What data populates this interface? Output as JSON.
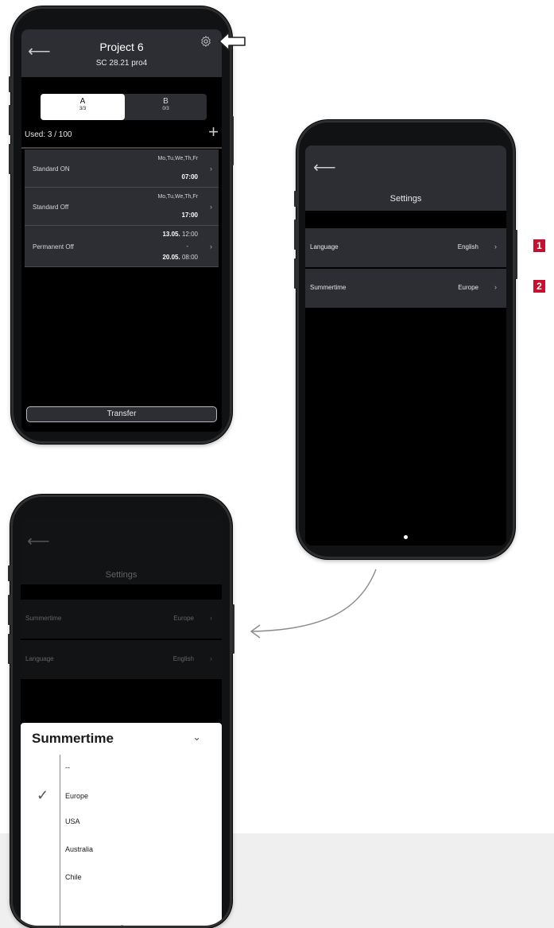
{
  "phone1": {
    "title": "Project 6",
    "subtitle": "SC 28.21 pro4",
    "tabs": [
      {
        "label": "A",
        "count": "3/3"
      },
      {
        "label": "B",
        "count": "0/3"
      }
    ],
    "used": "Used: 3 / 100",
    "rows": [
      {
        "name": "Standard  ON",
        "days": "Mo,Tu,We,Th,Fr",
        "time": "07:00"
      },
      {
        "name": "Standard  Off",
        "days": "Mo,Tu,We,Th,Fr",
        "time": "17:00"
      },
      {
        "name": "Permanent  Off",
        "start_date": "13.05.",
        "start_time": "12:00",
        "sep": "-",
        "end_date": "20.05.",
        "end_time": "08:00"
      }
    ],
    "transfer": "Transfer"
  },
  "phone2": {
    "title": "Settings",
    "rows": [
      {
        "label": "Language",
        "value": "English"
      },
      {
        "label": "Summertime",
        "value": "Europe"
      }
    ]
  },
  "phone3": {
    "title": "Settings",
    "rows": [
      {
        "label": "Summertime",
        "value": "Europe"
      },
      {
        "label": "Language",
        "value": "English"
      }
    ],
    "sheet_title": "Summertime",
    "options": [
      "--",
      "Europe",
      "USA",
      "Australia",
      "Chile"
    ],
    "selected": "Europe"
  },
  "badges": [
    "1",
    "2"
  ],
  "colors": {
    "header": "#2c2e33",
    "badge": "#c8102e",
    "screen": "#000000"
  }
}
